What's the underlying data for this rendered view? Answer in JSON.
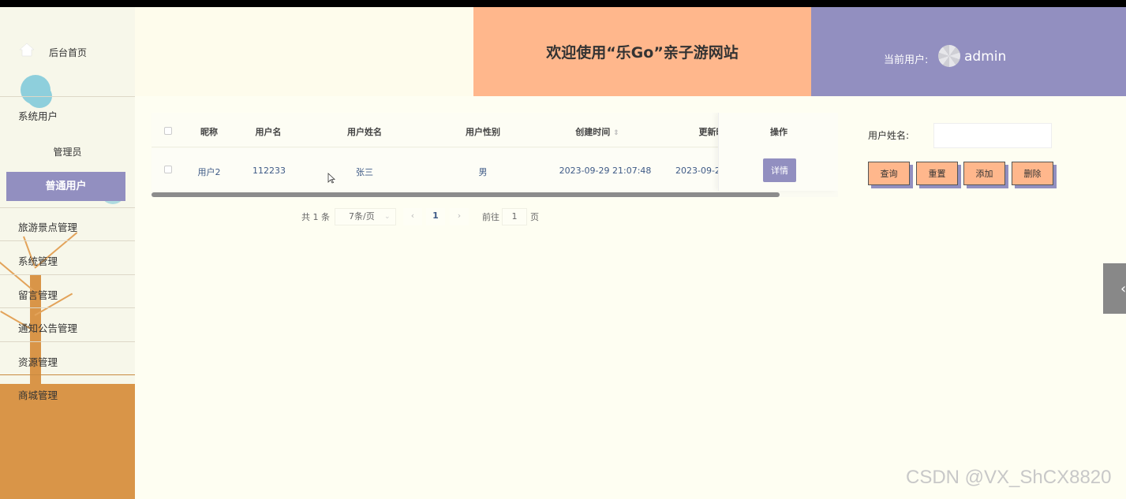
{
  "sidebar": {
    "home_label": "后台首页",
    "sections": [
      {
        "label": "系统用户",
        "sub_items": [
          {
            "label": "管理员"
          },
          {
            "label": "普通用户",
            "active": true
          }
        ]
      },
      {
        "label": "旅游景点管理"
      },
      {
        "label": "系统管理"
      },
      {
        "label": "留言管理"
      },
      {
        "label": "通知公告管理"
      },
      {
        "label": "资源管理"
      },
      {
        "label": "商城管理"
      }
    ]
  },
  "header": {
    "title": "欢迎使用“乐Go”亲子游网站",
    "user_label": "当前用户:",
    "user_name": "admin"
  },
  "table": {
    "columns": [
      "昵称",
      "用户名",
      "用户姓名",
      "用户性别",
      "创建时间",
      "更新时",
      "操作"
    ],
    "rows": [
      {
        "nickname": "用户2",
        "username": "112233",
        "realname": "张三",
        "gender": "男",
        "created": "2023-09-29 21:07:48",
        "updated": "2023-09-2"
      }
    ],
    "detail_label": "详情"
  },
  "pagination": {
    "total": "共 1 条",
    "page_size": "7条/页",
    "prev": "‹",
    "current_page": "1",
    "next": "›",
    "goto_label": "前往",
    "goto_value": "1",
    "page_unit": "页"
  },
  "search": {
    "label": "用户姓名:",
    "value": "",
    "buttons": {
      "query": "查询",
      "reset": "重置",
      "add": "添加",
      "delete": "删除"
    }
  },
  "watermark": "CSDN @VX_ShCX8820",
  "colors": {
    "accent_purple": "#928fc0",
    "accent_peach": "#ffb78c",
    "sidebar_orange": "#d99548"
  }
}
